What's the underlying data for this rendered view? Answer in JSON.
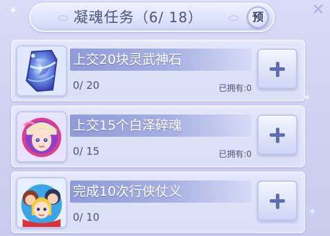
{
  "header": {
    "title": "凝魂任务",
    "count": "（6/ 18）",
    "preview_label": "预"
  },
  "tasks": [
    {
      "name": "上交20块灵武神石",
      "progress": "0/ 20",
      "owned_label": "已拥有:",
      "owned_value": "0",
      "icon": "crystal-stone-icon"
    },
    {
      "name": "上交15个白泽碎魂",
      "progress": "0/ 15",
      "owned_label": "已拥有:",
      "owned_value": "0",
      "icon": "baize-soul-portrait-icon"
    },
    {
      "name": "完成10次行侠仗义",
      "progress": "0/ 10",
      "owned_label": "",
      "owned_value": "",
      "icon": "heroes-group-portrait-icon"
    }
  ],
  "colors": {
    "accent": "#5f6db4",
    "name_bar": "#8f9bd8",
    "text": "#4d5478"
  }
}
